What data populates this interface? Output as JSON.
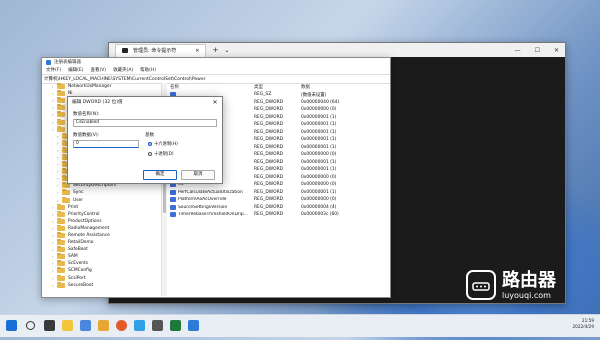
{
  "cmd": {
    "title": "管理员: 命令提示符",
    "tab_title": "管理员: 命令提示符",
    "new_tab": "+",
    "dropdown": "⌄",
    "minimize": "—",
    "maximize": "☐",
    "close": "✕"
  },
  "regedit": {
    "title": "注册表编辑器",
    "menu": [
      "文件(F)",
      "编辑(E)",
      "查看(V)",
      "收藏夹(A)",
      "帮助(H)"
    ],
    "address": "计算机\\HKEY_LOCAL_MACHINE\\SYSTEM\\CurrentControlSet\\Control\\Power",
    "tree": [
      {
        "label": "NetworkUxManager",
        "indent": 2
      },
      {
        "label": "Ni",
        "indent": 2
      },
      {
        "label": "No",
        "indent": 2
      },
      {
        "label": "No",
        "indent": 2
      },
      {
        "label": "Ni",
        "indent": 2
      },
      {
        "label": "Nu",
        "indent": 2
      },
      {
        "label": "Pa",
        "indent": 2
      },
      {
        "label": "",
        "indent": 3
      },
      {
        "label": "",
        "indent": 3
      },
      {
        "label": "",
        "indent": 3
      },
      {
        "label": "",
        "indent": 3
      },
      {
        "label": "",
        "indent": 3
      },
      {
        "label": "",
        "indent": 3
      },
      {
        "label": "",
        "indent": 3
      },
      {
        "label": "SecurityDescriptors",
        "indent": 3
      },
      {
        "label": "Sync",
        "indent": 3
      },
      {
        "label": "User",
        "indent": 3
      },
      {
        "label": "Print",
        "indent": 2
      },
      {
        "label": "PriorityControl",
        "indent": 2
      },
      {
        "label": "ProductOptions",
        "indent": 2
      },
      {
        "label": "RadioManagement",
        "indent": 2
      },
      {
        "label": "Remote Assistance",
        "indent": 2
      },
      {
        "label": "RetailDemo",
        "indent": 2
      },
      {
        "label": "SafeBoot",
        "indent": 2
      },
      {
        "label": "SAM",
        "indent": 2
      },
      {
        "label": "ScEvents",
        "indent": 2
      },
      {
        "label": "SCMConfig",
        "indent": 2
      },
      {
        "label": "ScsiPort",
        "indent": 2
      },
      {
        "label": "SecureBoot",
        "indent": 2
      }
    ],
    "columns": {
      "name": "名称",
      "type": "类型",
      "data": "数据"
    },
    "values": [
      {
        "name": "",
        "type": "REG_SZ",
        "data": "(数值未设置)"
      },
      {
        "name": "ount",
        "type": "REG_DWORD",
        "data": "0x00000040 (64)"
      },
      {
        "name": "",
        "type": "REG_DWORD",
        "data": "0x00000000 (0)"
      },
      {
        "name": "etup",
        "type": "REG_DWORD",
        "data": "0x00000001 (1)"
      },
      {
        "name": "ession",
        "type": "REG_DWORD",
        "data": "0x00000001 (1)"
      },
      {
        "name": "erSuppression",
        "type": "REG_DWORD",
        "data": "0x00000001 (1)"
      },
      {
        "name": "abled",
        "type": "REG_DWORD",
        "data": "0x00000001 (1)"
      },
      {
        "name": "abled",
        "type": "REG_DWORD",
        "data": "0x00000001 (1)"
      },
      {
        "name": "nt",
        "type": "REG_DWORD",
        "data": "0x00000000 (0)"
      },
      {
        "name": "Default",
        "type": "REG_DWORD",
        "data": "0x00000001 (1)"
      },
      {
        "name": "ceCheck",
        "type": "REG_DWORD",
        "data": "0x00000001 (1)"
      },
      {
        "name": "",
        "type": "REG_DWORD",
        "data": "0x00000000 (0)"
      },
      {
        "name": "ed",
        "type": "REG_DWORD",
        "data": "0x00000000 (0)"
      },
      {
        "name": "PerfCalculateActualUtilization",
        "type": "REG_DWORD",
        "data": "0x00000001 (1)"
      },
      {
        "name": "PlatformAoAcOverride",
        "type": "REG_DWORD",
        "data": "0x00000000 (0)"
      },
      {
        "name": "SourceSettingsVersion",
        "type": "REG_DWORD",
        "data": "0x00000004 (4)"
      },
      {
        "name": "TimerRebaseThresholdOnDrip...",
        "type": "REG_DWORD",
        "data": "0x0000003c (60)"
      }
    ]
  },
  "dialog": {
    "title": "编辑 DWORD (32 位)值",
    "close": "✕",
    "name_label": "数值名称(N):",
    "name_value": "CsEnabled",
    "data_label": "数值数据(V):",
    "data_value": "0",
    "base_label": "基数",
    "hex_label": "十六进制(H)",
    "dec_label": "十进制(D)",
    "ok": "确定",
    "cancel": "取消"
  },
  "tray": {
    "time": "21:59",
    "date": "2022/4/29"
  },
  "watermark": {
    "title": "路由器",
    "url": "luyouqi.com"
  }
}
